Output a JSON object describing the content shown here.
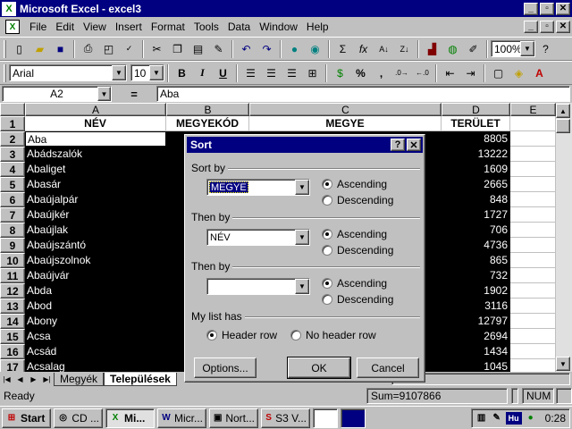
{
  "window": {
    "title": "Microsoft Excel - excel3",
    "min_label": "_",
    "max_label": "▫",
    "close_label": "✕"
  },
  "menu": {
    "items": [
      "File",
      "Edit",
      "View",
      "Insert",
      "Format",
      "Tools",
      "Data",
      "Window",
      "Help"
    ]
  },
  "toolbar1": {
    "zoom": "100%"
  },
  "toolbar2": {
    "font_name": "Arial",
    "font_size": "10",
    "bold_label": "B",
    "italic_label": "I",
    "underline_label": "U",
    "percent_label": "%",
    "comma_label": ","
  },
  "formula_bar": {
    "name_box": "A2",
    "equals": "=",
    "content": "Aba"
  },
  "grid": {
    "columns": [
      "A",
      "B",
      "C",
      "D",
      "E"
    ],
    "header_row": [
      "NÉV",
      "MEGYEKÓD",
      "MEGYE",
      "TERÜLET"
    ],
    "row_numbers": [
      "1",
      "2",
      "3",
      "4",
      "5",
      "6",
      "7",
      "8",
      "9",
      "10",
      "11",
      "12",
      "13",
      "14",
      "15",
      "16",
      "17"
    ],
    "names": [
      "Aba",
      "Abádszalók",
      "Abaliget",
      "Abasár",
      "Abaújalpár",
      "Abaújkér",
      "Abaújlak",
      "Abaújszántó",
      "Abaújszolnok",
      "Abaújvár",
      "Abda",
      "Abod",
      "Abony",
      "Acsa",
      "Acsád",
      "Acsalag"
    ],
    "areas": [
      "8805",
      "13222",
      "1609",
      "2665",
      "848",
      "1727",
      "706",
      "4736",
      "865",
      "732",
      "1902",
      "3116",
      "12797",
      "2694",
      "1434",
      "1045"
    ]
  },
  "sheet_tabs": {
    "tabs": [
      "Megyék",
      "Települések"
    ],
    "active": "Települések"
  },
  "status": {
    "ready": "Ready",
    "sum": "Sum=9107866",
    "num": "NUM"
  },
  "taskbar": {
    "start": "Start",
    "tasks": [
      "CD ...",
      "Mi...",
      "Micr...",
      "Nort...",
      "S3 V..."
    ],
    "hu": "Hu",
    "clock": "0:28"
  },
  "dialog": {
    "title": "Sort",
    "help_label": "?",
    "close_label": "✕",
    "sort_by_label": "Sort by",
    "sort_by_value": "MEGYE",
    "then_by_1_label": "Then by",
    "then_by_1_value": "NÉV",
    "then_by_2_label": "Then by",
    "then_by_2_value": "",
    "ascending": "Ascending",
    "descending": "Descending",
    "my_list_has": "My list has",
    "header_row": "Header row",
    "no_header_row": "No header row",
    "options_button": "Options...",
    "ok_button": "OK",
    "cancel_button": "Cancel"
  }
}
